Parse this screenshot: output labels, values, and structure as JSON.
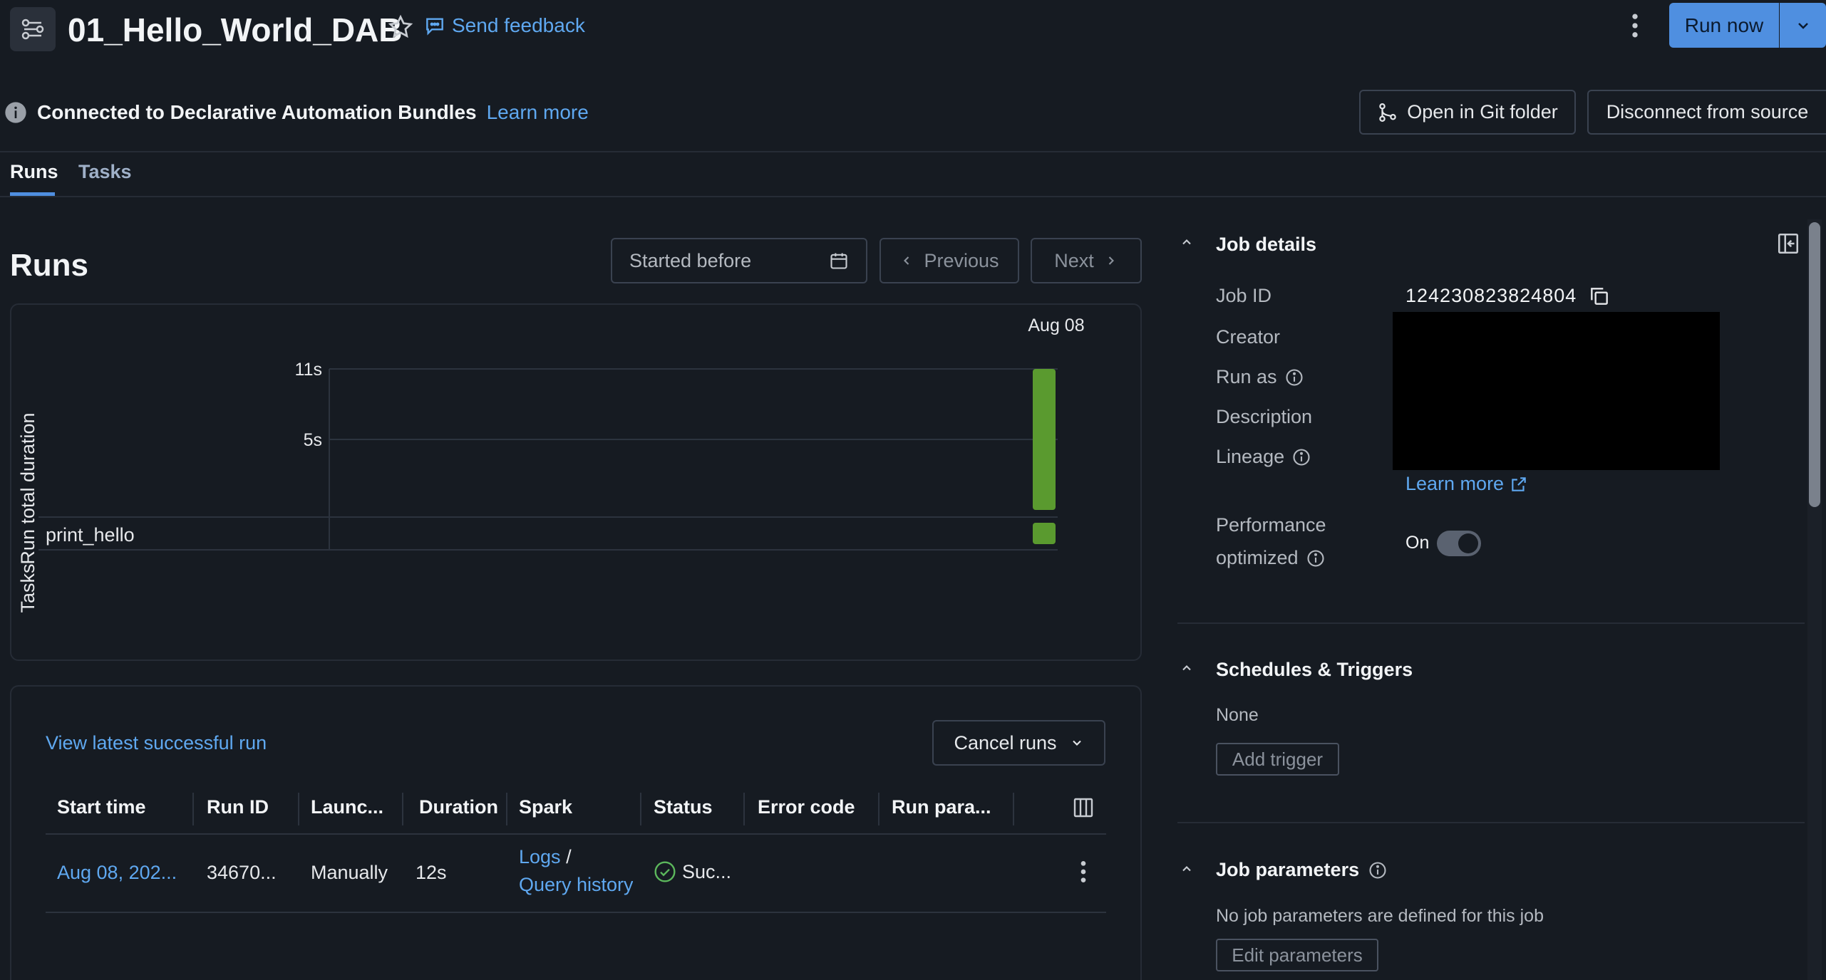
{
  "header": {
    "title": "01_Hello_World_DAB",
    "feedback_label": "Send feedback",
    "run_now_label": "Run now"
  },
  "info_bar": {
    "message": "Connected to Declarative Automation Bundles",
    "learn_more": "Learn more",
    "open_git_label": "Open in Git folder",
    "disconnect_label": "Disconnect from source"
  },
  "tabs": [
    {
      "label": "Runs",
      "active": true
    },
    {
      "label": "Tasks",
      "active": false
    }
  ],
  "runs": {
    "heading": "Runs",
    "filter_label": "Started before",
    "previous_label": "Previous",
    "next_label": "Next"
  },
  "chart_data": {
    "type": "bar",
    "categories": [
      "Aug 08"
    ],
    "values": [
      12
    ],
    "ylabel": "Run total duration",
    "yticks": [
      "11s",
      "5s"
    ],
    "ytick_values": [
      11,
      5
    ],
    "ylim": [
      0,
      11
    ],
    "task_lane_label": "Tasks",
    "tasks": [
      "print_hello"
    ],
    "colors": {
      "success": "#5a9a2f"
    }
  },
  "table": {
    "view_latest_link": "View latest successful run",
    "cancel_runs_label": "Cancel runs",
    "columns": [
      "Start time",
      "Run ID",
      "Launc...",
      "Duration",
      "Spark",
      "Status",
      "Error code",
      "Run para..."
    ],
    "rows": [
      {
        "start_time": "Aug 08, 202...",
        "run_id": "34670...",
        "launched": "Manually",
        "duration": "12s",
        "spark_logs": "Logs",
        "spark_sep": "/",
        "spark_query": "Query history",
        "status": "Suc..."
      }
    ]
  },
  "job_details": {
    "title": "Job details",
    "job_id_label": "Job ID",
    "job_id": "124230823824804",
    "creator_label": "Creator",
    "run_as_label": "Run as",
    "description_label": "Description",
    "lineage_label": "Lineage",
    "learn_more": "Learn more",
    "perf_label_1": "Performance",
    "perf_label_2": "optimized",
    "perf_value": "On"
  },
  "schedules": {
    "title": "Schedules & Triggers",
    "value": "None",
    "add_trigger_label": "Add trigger"
  },
  "job_parameters": {
    "title": "Job parameters",
    "empty_text": "No job parameters are defined for this job",
    "edit_label": "Edit parameters"
  },
  "colors": {
    "background": "#161b22",
    "accent": "#4f8fe0",
    "link": "#5fa8f0",
    "success": "#5a9a2f"
  }
}
